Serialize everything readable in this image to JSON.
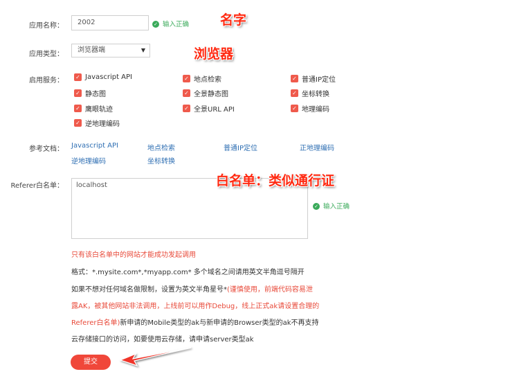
{
  "form": {
    "app_name": {
      "label": "应用名称：",
      "value": "2002",
      "valid_text": "输入正确"
    },
    "app_type": {
      "label": "应用类型：",
      "value": "浏览器端"
    },
    "services": {
      "label": "启用服务：",
      "items": [
        "Javascript API",
        "地点检索",
        "普通IP定位",
        "静态图",
        "全景静态图",
        "坐标转换",
        "鹰眼轨迹",
        "全景URL API",
        "地理编码",
        "逆地理编码"
      ]
    },
    "docs": {
      "label": "参考文档：",
      "links": [
        "Javascript API",
        "地点检索",
        "普通IP定位",
        "正地理编码",
        "逆地理编码",
        "坐标转换"
      ]
    },
    "referer": {
      "label": "Referer白名单：",
      "value": "localhost",
      "valid_text": "输入正确"
    },
    "notes": {
      "warning": "只有该白名单中的网站才能成功发起调用",
      "format": "格式：*.mysite.com*,*myapp.com* 多个域名之间请用英文半角逗号隔开",
      "line3_black": "如果不想对任何域名做限制，设置为英文半角星号*",
      "line3_red": "(谨慎使用，前端代码容易泄",
      "line4_red": "露AK，被其他网站非法调用，上线前可以用作Debug，线上正式ak请设置合理的",
      "line5_red": "Referer白名单)",
      "line5_black": "新申请的Mobile类型的ak与新申请的Browser类型的ak不再支持",
      "line6": "云存储接口的访问，如要使用云存储，请申请server类型ak"
    },
    "submit_label": "提交"
  },
  "annotations": {
    "name": "名字",
    "browser": "浏览器",
    "whitelist": "白名单：类似通行证"
  },
  "colors": {
    "accent": "#f0473a",
    "valid": "#3aaa5a",
    "link": "#2f6fb3",
    "annotation": "#ff2a12"
  }
}
